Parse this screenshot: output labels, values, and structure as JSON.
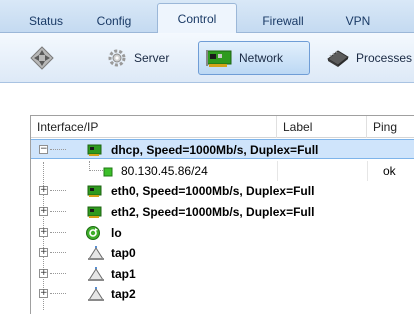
{
  "tabs": [
    {
      "label": "Status"
    },
    {
      "label": "Config"
    },
    {
      "label": "Control",
      "active": true
    },
    {
      "label": "Firewall"
    },
    {
      "label": "VPN"
    }
  ],
  "toolbar": {
    "items": [
      {
        "label": "",
        "icon": "diamond-arrows-icon"
      },
      {
        "label": "Server",
        "icon": "gear-icon"
      },
      {
        "label": "Network",
        "icon": "network-card-icon",
        "active": true
      },
      {
        "label": "Processes",
        "icon": "chip-icon"
      }
    ]
  },
  "grid": {
    "columns": [
      "Interface/IP",
      "Label",
      "Ping"
    ],
    "rows": [
      {
        "label": "dhcp, Speed=1000Mb/s, Duplex=Full",
        "icon": "network-card-icon",
        "expander": "−",
        "selected": true
      },
      {
        "label": "80.130.45.86/24",
        "icon": "ip-address-icon",
        "ping": "ok",
        "child": true
      },
      {
        "label": "eth0, Speed=1000Mb/s, Duplex=Full",
        "icon": "network-card-icon",
        "expander": "+"
      },
      {
        "label": "eth2, Speed=1000Mb/s, Duplex=Full",
        "icon": "network-card-icon",
        "expander": "+"
      },
      {
        "label": "lo",
        "icon": "loopback-icon",
        "expander": "+"
      },
      {
        "label": "tap0",
        "icon": "tap-icon",
        "expander": "+"
      },
      {
        "label": "tap1",
        "icon": "tap-icon",
        "expander": "+"
      },
      {
        "label": "tap2",
        "icon": "tap-icon",
        "expander": "+"
      }
    ]
  },
  "colors": {
    "selected_row": "#cfe4fb",
    "tab_bar": "#c4daf1",
    "network_green": "#2f9a1e"
  }
}
